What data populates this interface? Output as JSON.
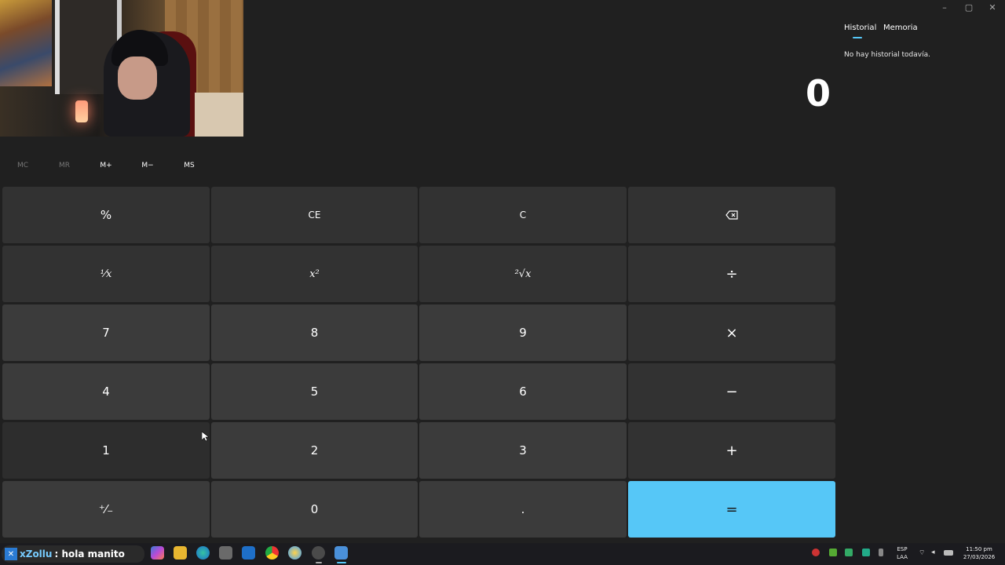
{
  "window": {
    "minimize_icon": "minimize-icon",
    "maximize_icon": "maximize-icon",
    "close_icon": "close-icon"
  },
  "calculator": {
    "display_value": "0",
    "memory": [
      "MC",
      "MR",
      "M+",
      "M−",
      "MS"
    ],
    "keys": {
      "percent": "%",
      "ce": "CE",
      "c": "C",
      "reciprocal": "¹⁄x",
      "square": "x²",
      "sqrt": "²√x",
      "divide": "÷",
      "seven": "7",
      "eight": "8",
      "nine": "9",
      "multiply": "×",
      "four": "4",
      "five": "5",
      "six": "6",
      "minus": "−",
      "one": "1",
      "two": "2",
      "three": "3",
      "plus": "+",
      "negate": "⁺⁄₋",
      "zero": "0",
      "decimal": ".",
      "equals": "="
    },
    "accent_color": "#56c7f7"
  },
  "side_panel": {
    "tabs": [
      "Historial",
      "Memoria"
    ],
    "empty_message": "No hay historial todavía."
  },
  "chat_overlay": {
    "user": "xZollu",
    "message": ": hola manito"
  },
  "taskbar": {
    "language_top": "ESP",
    "language_bottom": "LAA",
    "time": "11:50 pm",
    "date": "27/03/2026"
  }
}
